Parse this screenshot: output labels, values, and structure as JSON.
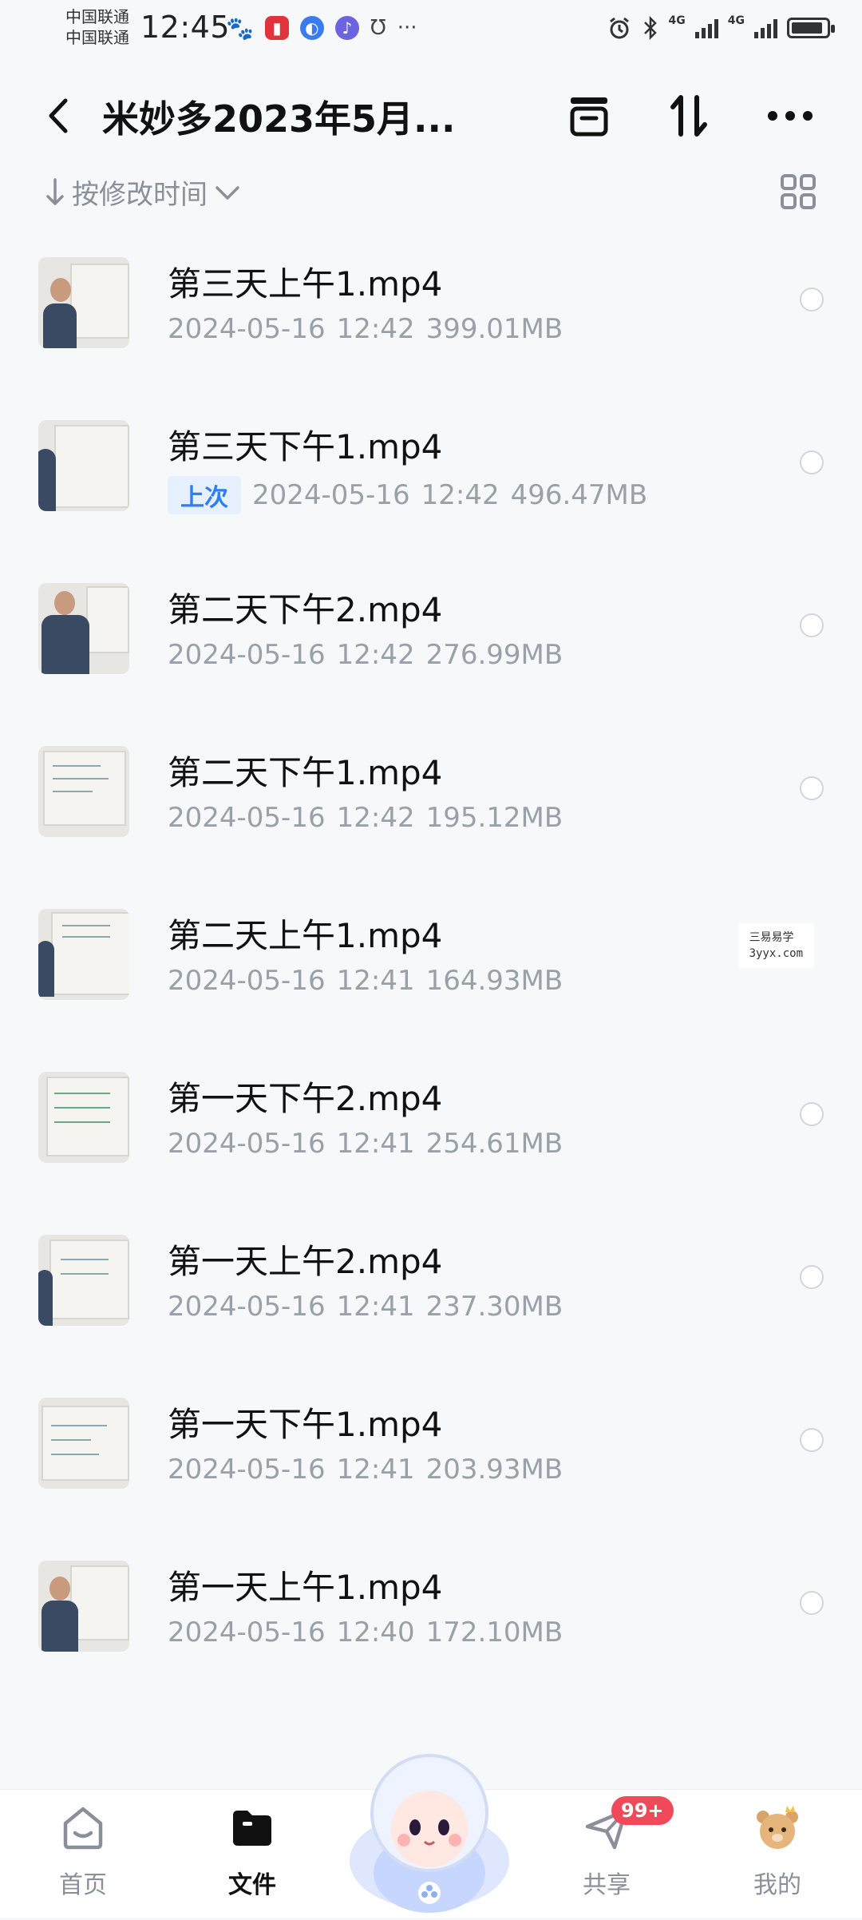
{
  "status_bar": {
    "carrier_1": "中国联通",
    "carrier_2": "中国联通",
    "time": "12:45",
    "more": "···",
    "signal_1": "4G",
    "signal_2": "4G"
  },
  "header": {
    "title": "米妙多2023年5月..."
  },
  "sort": {
    "label": "按修改时间"
  },
  "files": [
    {
      "name": "第三天上午1.mp4",
      "date": "2024-05-16",
      "time": "12:42",
      "size": "399.01MB",
      "tag": ""
    },
    {
      "name": "第三天下午1.mp4",
      "date": "2024-05-16",
      "time": "12:42",
      "size": "496.47MB",
      "tag": "上次"
    },
    {
      "name": "第二天下午2.mp4",
      "date": "2024-05-16",
      "time": "12:42",
      "size": "276.99MB",
      "tag": ""
    },
    {
      "name": "第二天下午1.mp4",
      "date": "2024-05-16",
      "time": "12:42",
      "size": "195.12MB",
      "tag": ""
    },
    {
      "name": "第二天上午1.mp4",
      "date": "2024-05-16",
      "time": "12:41",
      "size": "164.93MB",
      "tag": ""
    },
    {
      "name": "第一天下午2.mp4",
      "date": "2024-05-16",
      "time": "12:41",
      "size": "254.61MB",
      "tag": ""
    },
    {
      "name": "第一天上午2.mp4",
      "date": "2024-05-16",
      "time": "12:41",
      "size": "237.30MB",
      "tag": ""
    },
    {
      "name": "第一天下午1.mp4",
      "date": "2024-05-16",
      "time": "12:41",
      "size": "203.93MB",
      "tag": ""
    },
    {
      "name": "第一天上午1.mp4",
      "date": "2024-05-16",
      "time": "12:40",
      "size": "172.10MB",
      "tag": ""
    }
  ],
  "watermark": {
    "line1": "三易易学",
    "line2": "3yyx.com"
  },
  "bottom_nav": {
    "home": "首页",
    "files": "文件",
    "share": "共享",
    "share_badge": "99+",
    "me": "我的"
  },
  "colors": {
    "accent": "#2f7ef5",
    "badge": "#f04a5a",
    "meta_text": "#9aa0a8"
  }
}
